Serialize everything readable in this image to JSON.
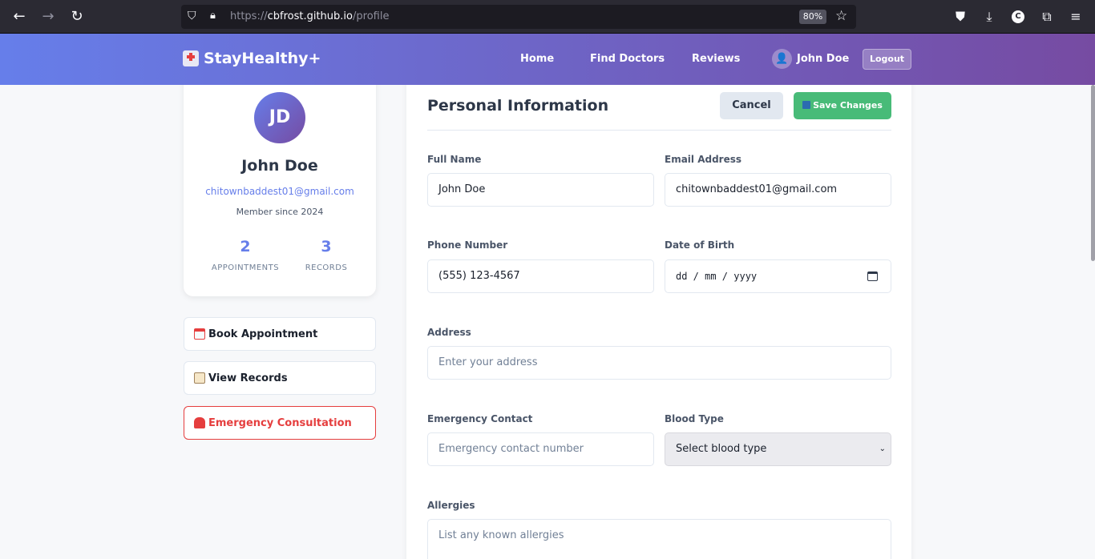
{
  "browser": {
    "url_scheme": "https://",
    "url_host": "cbfrost.github.io",
    "url_path": "/profile",
    "zoom": "80%",
    "account_initial": "C"
  },
  "header": {
    "brand": "StayHealthy+",
    "nav": [
      "Home",
      "Find Doctors",
      "Reviews"
    ],
    "user_name": "John Doe",
    "logout_label": "Logout"
  },
  "profile": {
    "initials": "JD",
    "name": "John Doe",
    "email": "chitownbaddest01@gmail.com",
    "member_since": "Member since 2024",
    "stats": [
      {
        "value": "2",
        "label": "APPOINTMENTS"
      },
      {
        "value": "3",
        "label": "RECORDS"
      }
    ]
  },
  "sidebar_actions": {
    "book": "Book Appointment",
    "records": "View Records",
    "emergency": "Emergency Consultation"
  },
  "form": {
    "title": "Personal Information",
    "cancel_label": "Cancel",
    "save_label": "Save Changes",
    "full_name": {
      "label": "Full Name",
      "value": "John Doe"
    },
    "email": {
      "label": "Email Address",
      "value": "chitownbaddest01@gmail.com"
    },
    "phone": {
      "label": "Phone Number",
      "value": "(555) 123-4567"
    },
    "dob": {
      "label": "Date of Birth",
      "placeholder": "dd / mm / yyyy"
    },
    "address": {
      "label": "Address",
      "placeholder": "Enter your address"
    },
    "emergency_contact": {
      "label": "Emergency Contact",
      "placeholder": "Emergency contact number"
    },
    "blood_type": {
      "label": "Blood Type",
      "selected": "Select blood type"
    },
    "allergies": {
      "label": "Allergies",
      "placeholder": "List any known allergies"
    }
  },
  "colors": {
    "accent": "#667eea",
    "gradient_end": "#764ba2",
    "success": "#48bb78",
    "danger": "#e53e3e"
  }
}
